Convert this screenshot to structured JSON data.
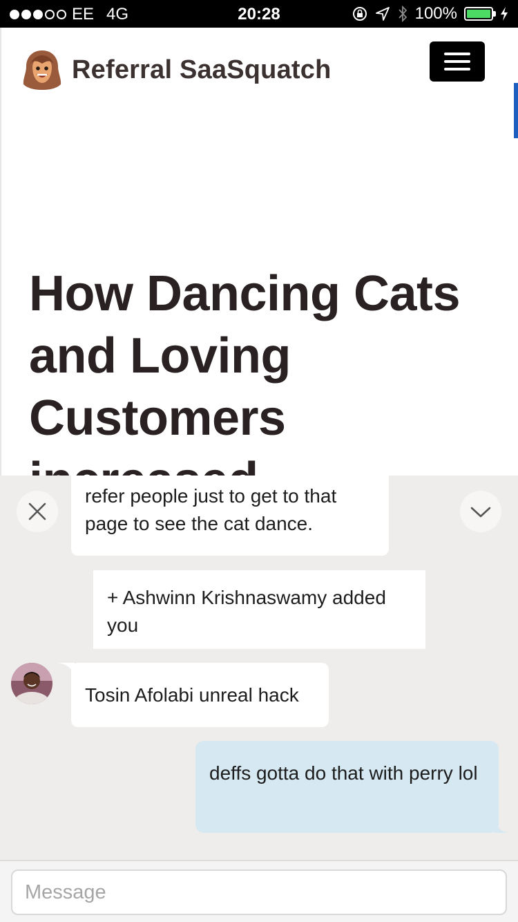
{
  "status_bar": {
    "carrier": "EE",
    "network": "4G",
    "time": "20:28",
    "battery": "100%",
    "battery_level": 1.0,
    "signal_bars_filled": 3,
    "signal_bars_total": 5,
    "icons": [
      "orientation-lock-icon",
      "location-arrow-icon",
      "bluetooth-icon",
      "charging-bolt-icon"
    ]
  },
  "site": {
    "brand": "Referral SaaSquatch",
    "logo_icon": "sasquatch-face-icon",
    "menu_icon": "hamburger-menu-icon",
    "headline": "How Dancing Cats and Loving Customers increased"
  },
  "chat": {
    "close_icon": "close-x-icon",
    "collapse_icon": "chevron-down-icon",
    "messages": [
      {
        "type": "incoming",
        "text": "refer people just to get to that page to see the cat dance."
      },
      {
        "type": "system",
        "text": "+ Ashwinn Krishnaswamy added you"
      },
      {
        "type": "incoming",
        "text": "Tosin Afolabi unreal hack"
      },
      {
        "type": "outgoing",
        "text": "deffs gotta do that with perry lol"
      }
    ],
    "composer": {
      "placeholder": "Message"
    }
  },
  "colors": {
    "accent": "#1d5fbf",
    "chat_background": "#eeedec",
    "outgoing_bubble": "#d6e8f1",
    "battery_fill": "#4cd964"
  }
}
